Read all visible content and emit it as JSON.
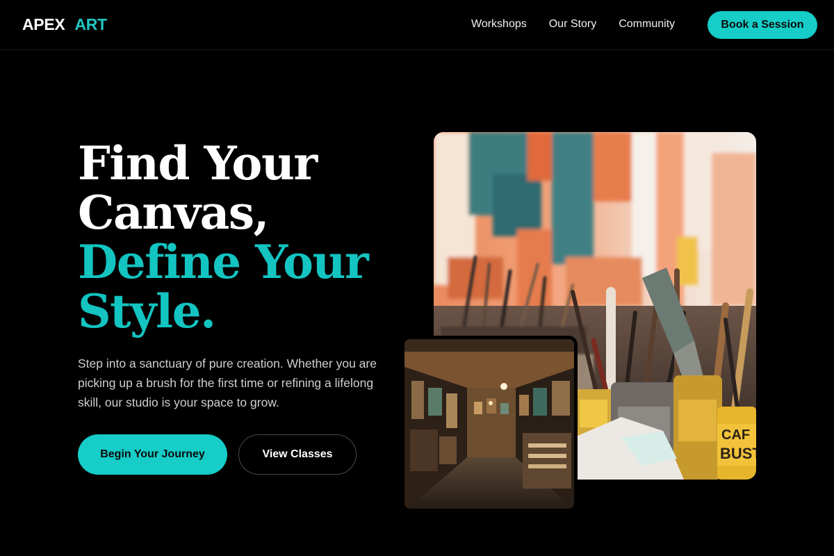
{
  "brand": {
    "word1": "APEX",
    "word2": "ART"
  },
  "nav": {
    "links": [
      "Workshops",
      "Our Story",
      "Community"
    ],
    "cta": "Book a Session"
  },
  "hero": {
    "title_lines": [
      "Find Your",
      "Canvas,"
    ],
    "accent_lines": [
      "Define Your",
      "Style."
    ],
    "subtitle": "Step into a sanctuary of pure creation. Whether you are picking up a brush for the first time or refining a lifelong skill, our studio is your space to grow.",
    "primary_button": "Begin Your Journey",
    "secondary_button": "View Classes"
  },
  "images": {
    "main": {
      "can_label_top": "CAF",
      "can_label_bottom": "BUST"
    },
    "secondary": "gallery-corridor-photo"
  },
  "colors": {
    "accent": "#16cdc8",
    "background": "#000000",
    "text": "#ffffff"
  }
}
